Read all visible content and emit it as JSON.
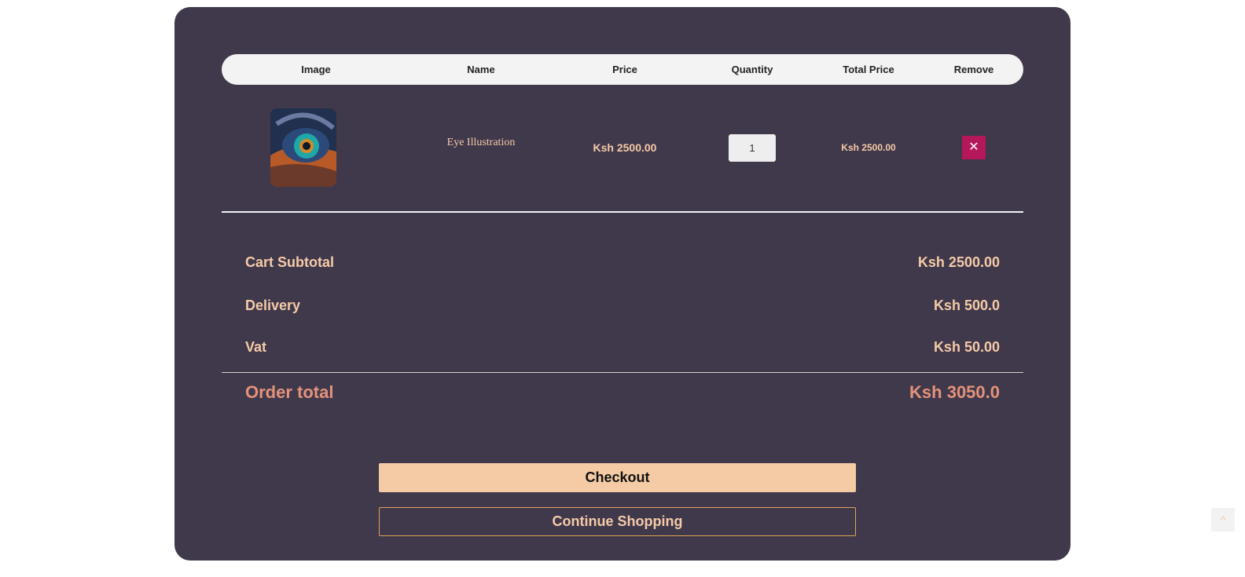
{
  "table": {
    "headers": {
      "image": "Image",
      "name": "Name",
      "price": "Price",
      "quantity": "Quantity",
      "total_price": "Total Price",
      "remove": "Remove"
    },
    "items": [
      {
        "image_alt": "eye-illustration-image",
        "name": "Eye Illustration",
        "price": "Ksh 2500.00",
        "quantity": "1",
        "total_price": "Ksh 2500.00",
        "remove_icon": "close-icon",
        "remove_symbol": "✕"
      }
    ]
  },
  "summary": {
    "subtotal_label": "Cart Subtotal",
    "subtotal_value": "Ksh 2500.00",
    "delivery_label": "Delivery",
    "delivery_value": "Ksh 500.0",
    "vat_label": "Vat",
    "vat_value": "Ksh 50.00",
    "order_total_label": "Order total",
    "order_total_value": "Ksh 3050.0"
  },
  "actions": {
    "checkout_label": "Checkout",
    "continue_label": "Continue Shopping"
  },
  "scroll_top": {
    "icon": "chevron-up-icon",
    "symbol": "^"
  },
  "colors": {
    "panel": "#40384b",
    "accent_text": "#f5cba7",
    "order_total": "#e3937a",
    "checkout": "#f4cba5",
    "remove": "#b5175b"
  }
}
